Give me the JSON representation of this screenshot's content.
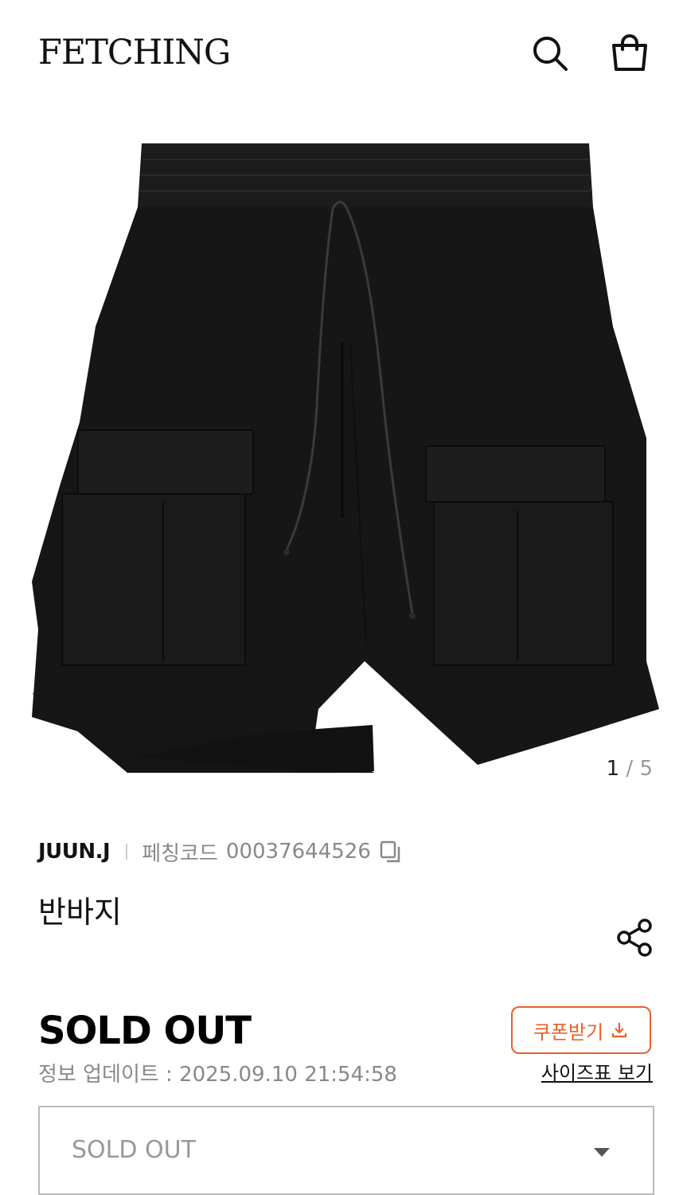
{
  "header": {
    "logo": "FETCHING",
    "search_icon": "search-icon",
    "bag_icon": "shopping-bag-icon"
  },
  "gallery": {
    "current": "1",
    "separator": "/",
    "total": "5"
  },
  "product": {
    "brand": "JUUN.J",
    "code_label": "페칭코드",
    "code": "00037644526",
    "name": "반바지",
    "price": "SOLD OUT",
    "updated": "정보 업데이트 : 2025.09.10 21:54:58"
  },
  "actions": {
    "coupon_label": "쿠폰받기",
    "size_chart_label": "사이즈표 보기",
    "share_icon": "share-icon",
    "copy_icon": "copy-icon"
  },
  "option_select": {
    "value": "SOLD OUT"
  },
  "colors": {
    "accent": "#e8602c",
    "text": "#111111",
    "muted": "#888888"
  }
}
